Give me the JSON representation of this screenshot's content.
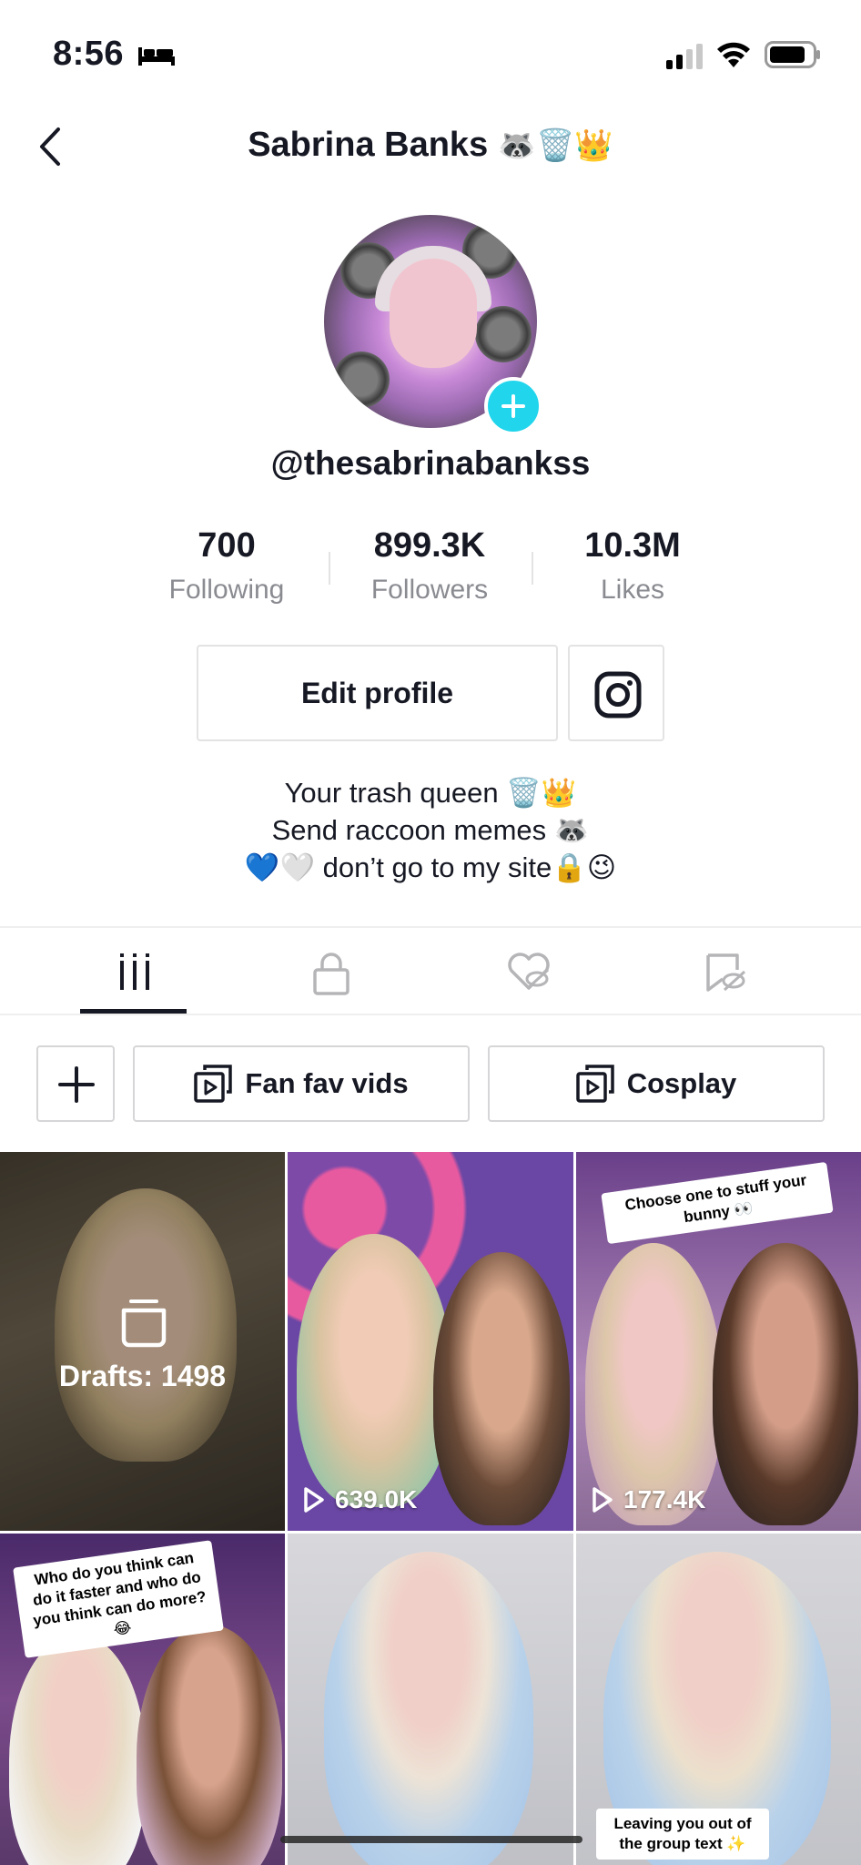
{
  "status_bar": {
    "time": "8:56",
    "icons": [
      "sleep-bed-icon",
      "signal-icon",
      "wifi-icon",
      "battery-icon"
    ]
  },
  "header": {
    "back_icon": "chevron-left-icon",
    "title": "Sabrina Banks",
    "title_emoji": "🦝🗑️👑"
  },
  "profile": {
    "username": "@thesabrinabankss",
    "avatar_add_icon": "plus-icon",
    "stats": [
      {
        "value": "700",
        "label": "Following"
      },
      {
        "value": "899.3K",
        "label": "Followers"
      },
      {
        "value": "10.3M",
        "label": "Likes"
      }
    ],
    "edit_button": "Edit profile",
    "instagram_icon": "instagram-icon",
    "bio": [
      "Your trash queen 🗑️👑",
      "Send raccoon memes 🦝",
      "💙🤍 don’t go to my site🔒😉"
    ]
  },
  "tabs": [
    {
      "icon": "grid-videos-icon",
      "active": true
    },
    {
      "icon": "lock-icon",
      "active": false
    },
    {
      "icon": "heart-hidden-icon",
      "active": false
    },
    {
      "icon": "bookmark-hidden-icon",
      "active": false
    }
  ],
  "playlists": {
    "add_icon": "plus-icon",
    "items": [
      {
        "label": "Fan fav vids",
        "icon": "playlist-icon"
      },
      {
        "label": "Cosplay",
        "icon": "playlist-icon"
      }
    ]
  },
  "videos": [
    {
      "type": "drafts",
      "label": "Drafts: 1498",
      "icon": "drafts-box-icon"
    },
    {
      "type": "video",
      "views": "639.0K"
    },
    {
      "type": "video",
      "views": "177.4K",
      "caption": "Choose one to stuff your bunny 👀"
    },
    {
      "type": "video",
      "caption": "Who do you think can do it faster and who do you think can do more? 😂"
    },
    {
      "type": "video"
    },
    {
      "type": "video",
      "caption": "Leaving you out of the group text ✨"
    }
  ],
  "colors": {
    "accent_cyan": "#20d5ec",
    "text_primary": "#161823",
    "text_secondary": "#8a8b91",
    "border": "#e3e3e4"
  }
}
